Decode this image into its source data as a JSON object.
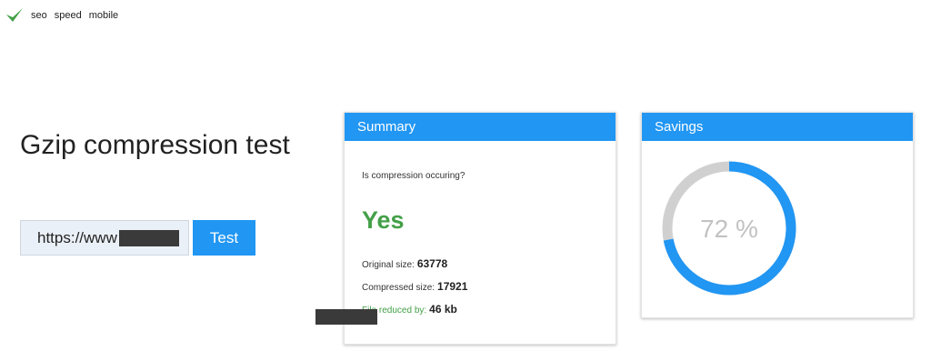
{
  "nav": {
    "logo": "checkmark-icon",
    "links": [
      "seo",
      "speed",
      "mobile"
    ]
  },
  "page_title": "Gzip compression test",
  "form": {
    "url_value": "https://www",
    "test_label": "Test"
  },
  "summary": {
    "header": "Summary",
    "question": "Is compression occuring?",
    "answer": "Yes",
    "original_label": "Original size:",
    "original_value": "63778",
    "compressed_label": "Compressed size:",
    "compressed_value": "17921",
    "reduced_label_prefix": "File",
    "reduced_label": "reduced by:",
    "reduced_value": "46 kb"
  },
  "savings": {
    "header": "Savings",
    "percent": 72,
    "percent_text": "72 %"
  },
  "colors": {
    "accent": "#2196f3",
    "success": "#43a047",
    "ring_track": "#d0d0d0"
  }
}
